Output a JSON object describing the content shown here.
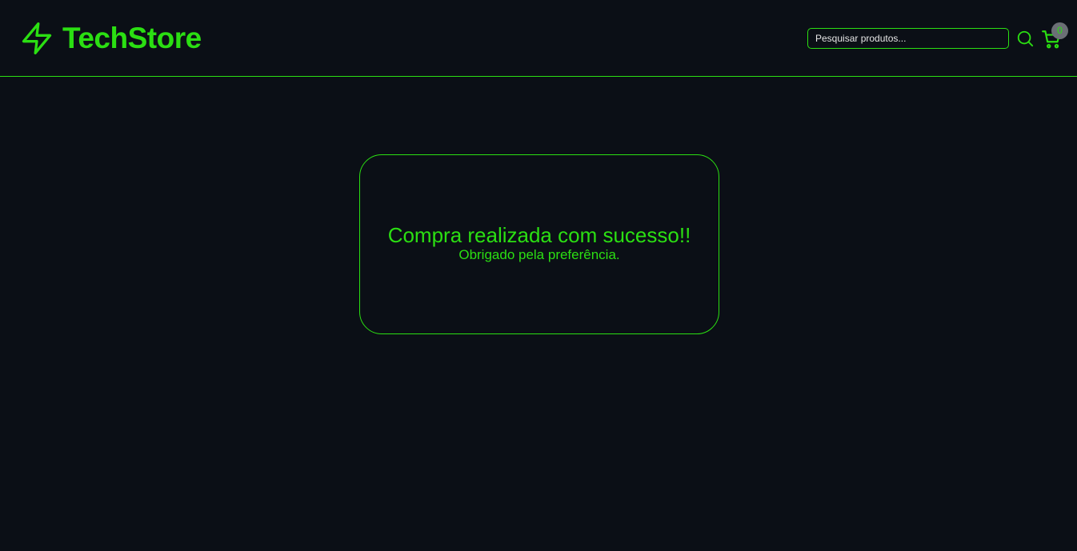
{
  "header": {
    "brand": "TechStore",
    "logo_icon": "lightning-bolt-icon",
    "search_placeholder": "Pesquisar produtos...",
    "search_icon": "search-icon",
    "cart_icon": "shopping-cart-icon",
    "cart_count": "0"
  },
  "main": {
    "title": "Compra realizada com sucesso!!",
    "subtitle": "Obrigado pela preferência."
  },
  "colors": {
    "background": "#0b0f16",
    "accent": "#2bdf12",
    "badge": "#6b6f75"
  }
}
